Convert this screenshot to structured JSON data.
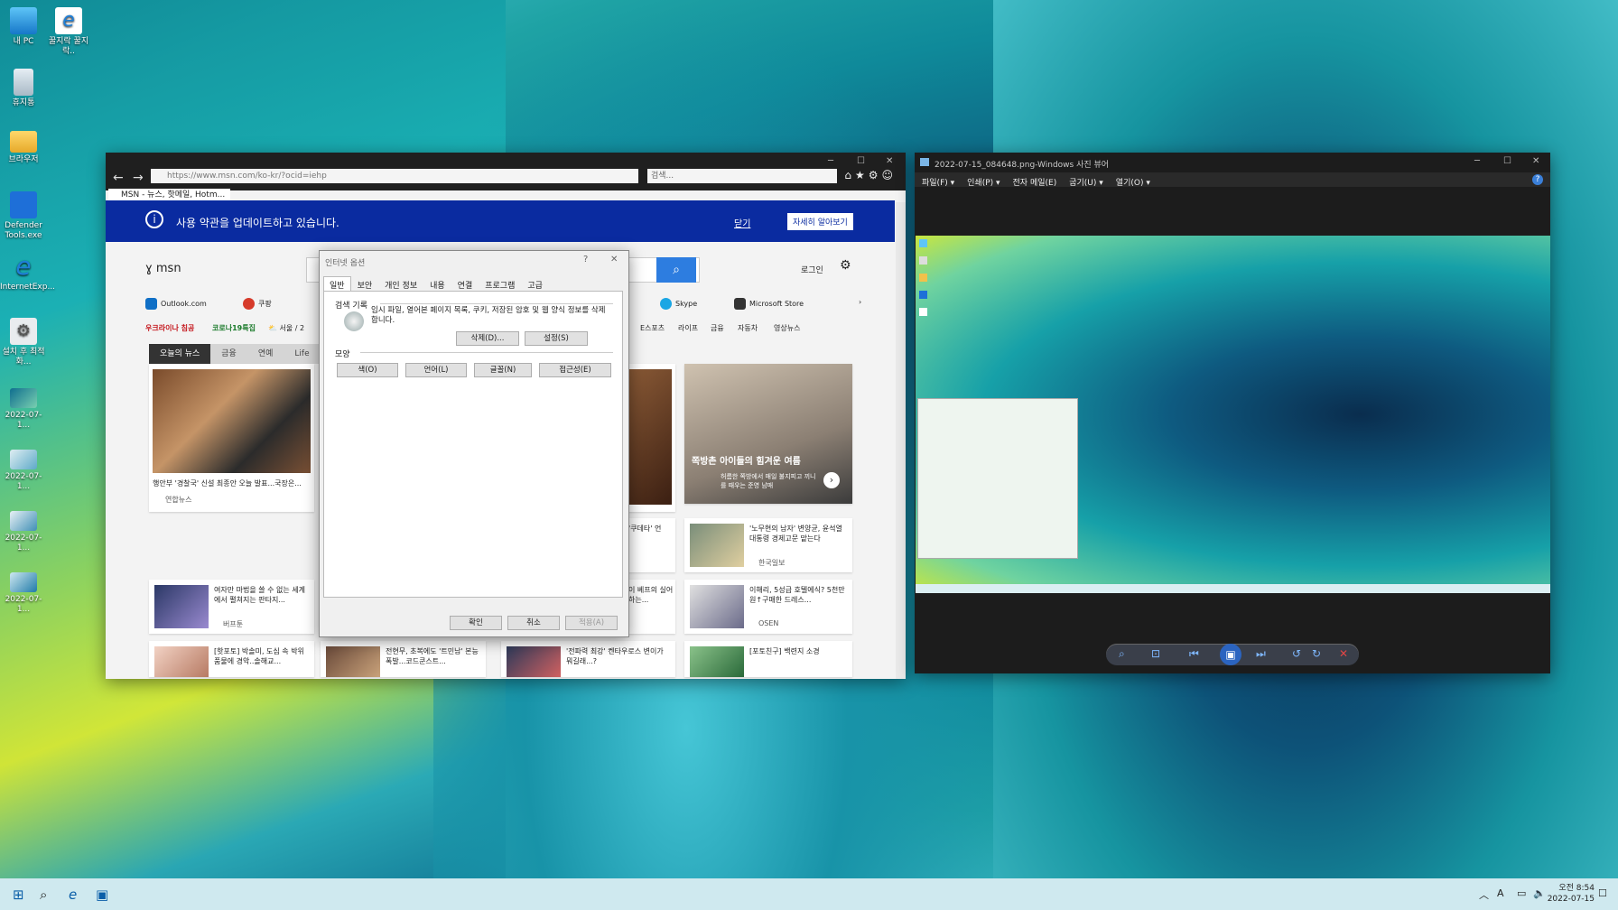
{
  "desktop": {
    "icons": [
      {
        "label": "내 PC"
      },
      {
        "label": "꿀지락 꿀지락.."
      },
      {
        "label": "휴지통"
      },
      {
        "label": "브라우저"
      },
      {
        "label": "Defender Tools.exe"
      },
      {
        "label": "InternetExp..."
      },
      {
        "label": "설치 후 최적화..."
      },
      {
        "label": "2022-07-1..."
      },
      {
        "label": "2022-07-1..."
      },
      {
        "label": "2022-07-1..."
      },
      {
        "label": "2022-07-1..."
      }
    ]
  },
  "ie": {
    "address": "https://www.msn.com/ko-kr/?ocid=iehp",
    "search_placeholder": "검색...",
    "tab_title": "MSN - 뉴스, 핫메일, Hotm...",
    "notice": {
      "text": "사용 약관을 업데이트하고 있습니다.",
      "close": "닫기",
      "more": "자세히 알아보기"
    },
    "msn": {
      "logo": "msn",
      "login": "로그인",
      "shortcuts": [
        "Outlook.com",
        "쿠팡",
        "Skype",
        "Microsoft Store"
      ],
      "cats_left": [
        "우크라이나 침공",
        "코로나19특집",
        "서울 / 2"
      ],
      "cats_right": [
        "E스포츠",
        "라이프",
        "금융",
        "자동차",
        "영상뉴스"
      ],
      "news_tabs": [
        "오늘의 뉴스",
        "금융",
        "연예",
        "Life"
      ],
      "cards": [
        {
          "title": "행안부 '경찰국' 신설 최종안 오늘 발표...국장은...",
          "source": "연합뉴스"
        },
        {
          "title": "쪽방촌 아이들의 힘겨운 여름",
          "source": "허름한 쪽방에서 매일 불지피고 끼니를 때우는 준영 남매"
        },
        {
          "title": "'노무현의 남자' 변양균, 윤석열 대통령 경제고문 맡는다",
          "source": "한국일보"
        },
        {
          "title": "여자만 마법을 쓸 수 없는 세계에서 펼쳐지는 판타지...",
          "source": "버프툰"
        },
        {
          "title": "이해리, 5성급 호텔에식? 5천만원↑구매한 드레스...",
          "source": "OSEN"
        },
        {
          "title": "[핫포토] 박솔미, 도심 속 박위 품물에 경악..솔해교...",
          "source": ""
        },
        {
          "title": "전현무, 초복에도 '트민남' 본능 폭발...코드쿤스트...",
          "source": ""
        },
        {
          "title": "'전파력 최강' 켄타우로스 변이가 뭐길래...?",
          "source": ""
        },
        {
          "title": "[포토친구] 백련지 소경",
          "source": ""
        },
        {
          "title": "'쿠데타' 언",
          "source": ""
        },
        {
          "title": "이 베프의 실어하는...",
          "source": ""
        }
      ]
    }
  },
  "dialog": {
    "title": "인터넷 옵션",
    "tabs": [
      "일반",
      "보안",
      "개인 정보",
      "내용",
      "연결",
      "프로그램",
      "고급"
    ],
    "history_group": "검색 기록",
    "history_desc": "임시 파일, 열어본 페이지 목록, 쿠키, 저장된 암호 및 웹 양식 정보를 삭제합니다.",
    "delete_btn": "삭제(D)...",
    "settings_btn": "설정(S)",
    "appearance_group": "모양",
    "appearance_btns": [
      "색(O)",
      "언어(L)",
      "글꼴(N)",
      "접근성(E)"
    ],
    "ok": "확인",
    "cancel": "취소",
    "apply": "적용(A)"
  },
  "photo_viewer": {
    "title": "2022-07-15_084648.png-Windows 사진 뷰어",
    "menu": [
      "파일(F) ▾",
      "인쇄(P) ▾",
      "전자 메일(E)",
      "굽기(U) ▾",
      "열기(O) ▾"
    ]
  },
  "taskbar": {
    "time": "오전 8:54",
    "date": "2022-07-15"
  }
}
